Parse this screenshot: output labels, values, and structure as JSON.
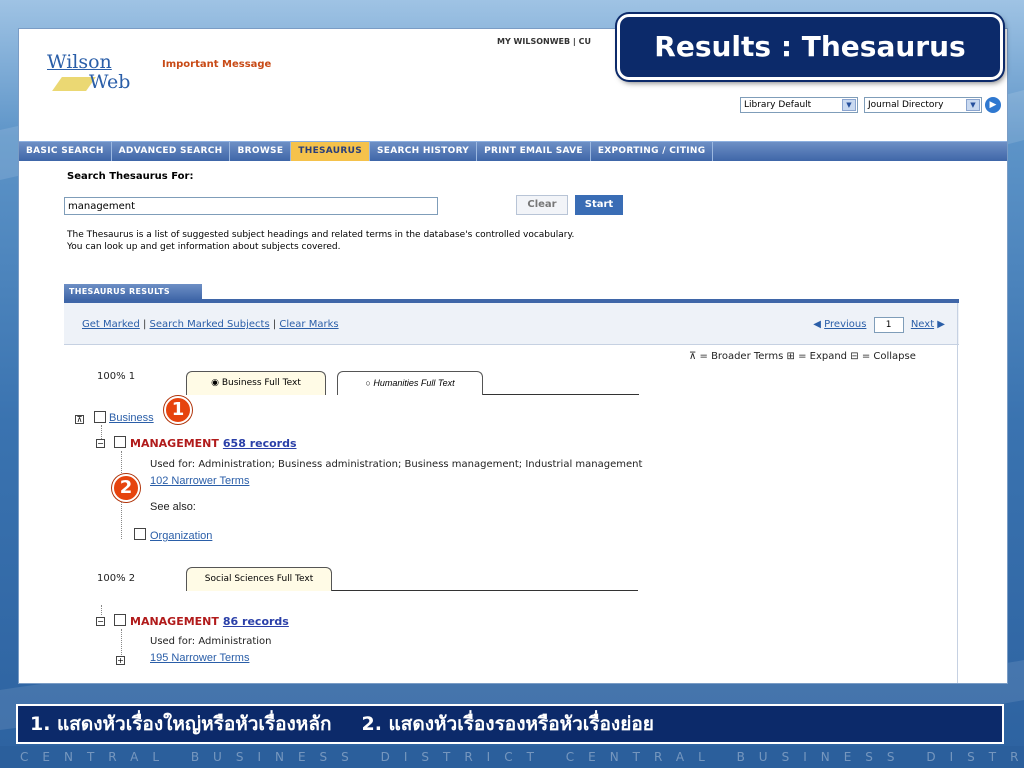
{
  "slide": {
    "title": "Results : Thesaurus",
    "caption_1": "1. แสดงหัวเรื่องใหญ่หรือหัวเรื่องหลัก",
    "caption_2": "2. แสดงหัวเรื่องรองหรือหัวเรื่องย่อย",
    "footer_text": "CENTRAL BUSINESS DISTRICT CENTRAL BUSINESS DISTRICT CENTRA",
    "markers": [
      "1",
      "2"
    ]
  },
  "header": {
    "logo_line1": "Wilson",
    "logo_line2": "Web",
    "important_message": "Important Message",
    "top_links": "MY WILSONWEB | CU",
    "library_select": "Library Default",
    "journal_select": "Journal Directory",
    "go_icon": "arrow-right-circle-icon"
  },
  "nav": {
    "items": [
      "BASIC SEARCH",
      "ADVANCED SEARCH",
      "BROWSE",
      "THESAURUS",
      "SEARCH HISTORY",
      "PRINT EMAIL SAVE",
      "EXPORTING / CITING"
    ],
    "active": "THESAURUS"
  },
  "search": {
    "label": "Search Thesaurus For:",
    "value": "management",
    "clear_label": "Clear",
    "start_label": "Start",
    "desc_line1": "The Thesaurus is a list of suggested subject headings and related terms in the database's controlled vocabulary.",
    "desc_line2": "You can look up and get information about subjects covered."
  },
  "results": {
    "tab_label": "THESAURUS RESULTS",
    "get_marked": "Get Marked",
    "search_marked": "Search Marked Subjects",
    "clear_marks": "Clear Marks",
    "previous": "Previous",
    "page": "1",
    "next": "Next",
    "legend": "= Broader Terms  = Expand  = Collapse",
    "legend_broader": "= Broader Terms",
    "legend_expand": "= Expand",
    "legend_collapse": "= Collapse"
  },
  "group1": {
    "pct": "100% 1",
    "tab_active": "Business Full Text",
    "tab_other": "Humanities Full Text",
    "broader": "Business",
    "term": "MANAGEMENT",
    "records": "658 records",
    "used_for": "Used for: Administration; Business administration; Business management; Industrial management",
    "narrower": "102 Narrower Terms",
    "see_also": "See also:",
    "related": "Organization"
  },
  "group2": {
    "pct": "100% 2",
    "tab_active": "Social Sciences Full Text",
    "term": "MANAGEMENT",
    "records": "86 records",
    "used_for": "Used for: Administration",
    "narrower": "195 Narrower Terms"
  },
  "colors": {
    "accent": "#f5c24b",
    "nav": "#3f66a8",
    "term": "#b11b1b",
    "marker": "#e6440e",
    "badge": "#0c2a6a"
  }
}
